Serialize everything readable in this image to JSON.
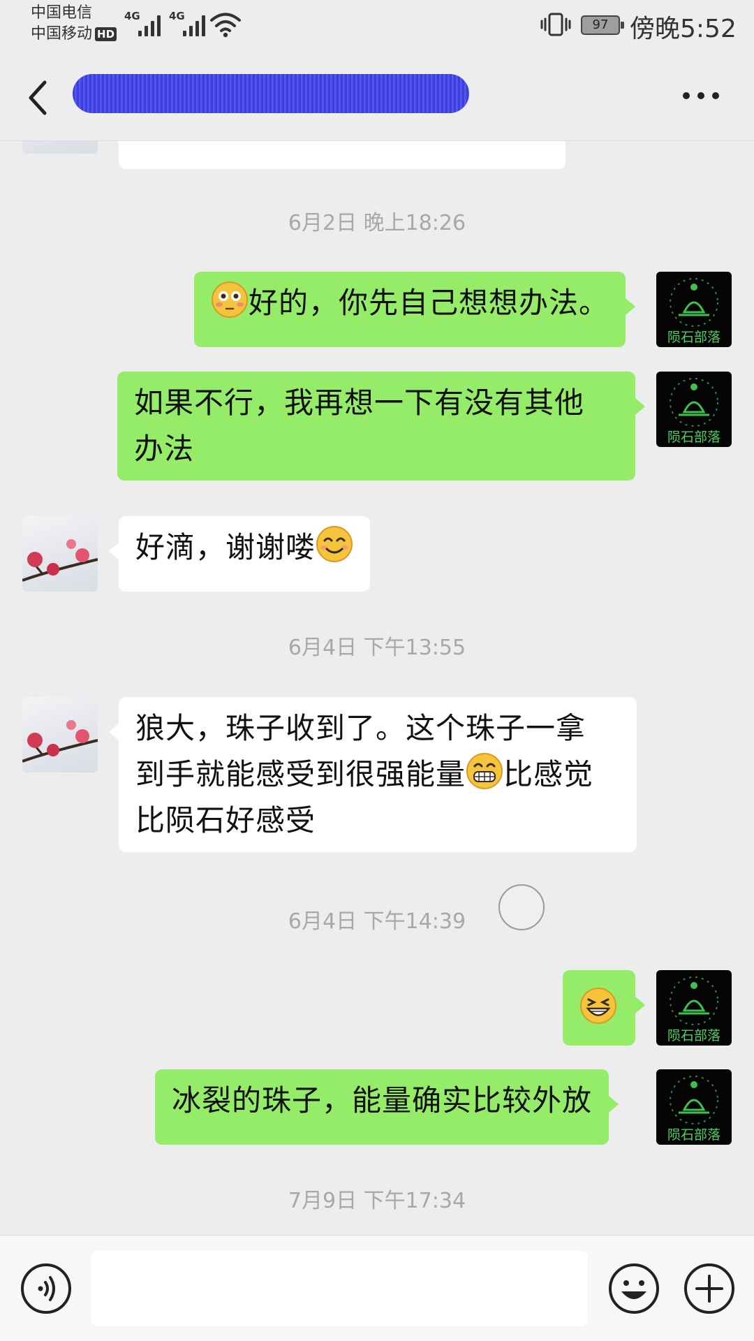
{
  "status_bar": {
    "carrier_1": "中国电信",
    "carrier_2": "中国移动",
    "hd_badge": "HD",
    "network_1": "4G",
    "network_2": "4G",
    "battery": "97",
    "time": "傍晚5:52"
  },
  "header": {
    "back_icon": "chevron-left-icon",
    "title": "",
    "more_icon": "more-dots-icon"
  },
  "messages": [
    {
      "kind": "timestamp",
      "text": "6月2日 晚上18:26"
    },
    {
      "kind": "out",
      "emoji": "flushed-face",
      "text": "好的，你先自己想想办法。"
    },
    {
      "kind": "out",
      "line1": "如果不行，我再想一下有没有其他",
      "line2": "办法"
    },
    {
      "kind": "in",
      "text": "好滴，谢谢喽",
      "emoji": "smiling-face"
    },
    {
      "kind": "timestamp",
      "text": "6月4日 下午13:55"
    },
    {
      "kind": "in",
      "line1": "狼大，珠子收到了。这个珠子一拿",
      "line2a": "到手就能感受到很强能量",
      "emoji": "grinning-face",
      "line2b": "比感觉",
      "line3": "比陨石好感受"
    },
    {
      "kind": "timestamp",
      "text": "6月4日 下午14:39"
    },
    {
      "kind": "out",
      "emoji": "grinning-squint-face",
      "text": ""
    },
    {
      "kind": "out",
      "text": "冰裂的珠子，能量确实比较外放"
    },
    {
      "kind": "timestamp",
      "text": "7月9日 下午17:34"
    }
  ],
  "avatars": {
    "self_logo_text": "陨石部落"
  },
  "input_bar": {
    "voice_icon": "voice-icon",
    "input_value": "",
    "emoji_icon": "emoji-icon",
    "plus_icon": "plus-icon"
  },
  "colors": {
    "background": "#ededed",
    "outgoing_bubble": "#95ec69",
    "incoming_bubble": "#ffffff",
    "timestamp": "#a8a8a8",
    "title_redaction": "#3b3fe0"
  }
}
